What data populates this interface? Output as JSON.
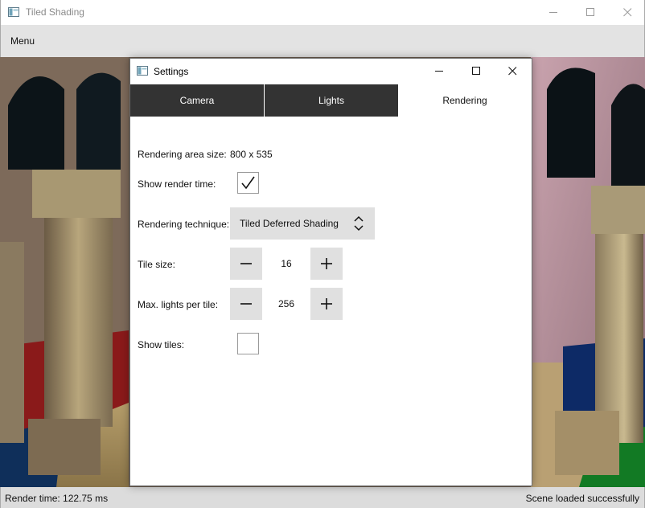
{
  "window": {
    "title": "Tiled Shading"
  },
  "menubar": {
    "menu_label": "Menu"
  },
  "statusbar": {
    "render_time": "Render time: 122.75 ms",
    "status_message": "Scene loaded successfully"
  },
  "dialog": {
    "title": "Settings",
    "tabs": [
      {
        "label": "Camera",
        "active": false
      },
      {
        "label": "Lights",
        "active": false
      },
      {
        "label": "Rendering",
        "active": true
      }
    ],
    "rendering": {
      "area_size_label": "Rendering area size:",
      "area_size_value": "800 x 535",
      "show_render_time_label": "Show render time:",
      "show_render_time_checked": true,
      "technique_label": "Rendering technique:",
      "technique_value": "Tiled Deferred Shading",
      "tile_size_label": "Tile size:",
      "tile_size_value": "16",
      "max_lights_label": "Max. lights per tile:",
      "max_lights_value": "256",
      "show_tiles_label": "Show tiles:",
      "show_tiles_checked": false
    }
  },
  "colors": {
    "tab_inactive": "#333333",
    "control_bg": "#e0e0e0",
    "menubar_bg": "#e3e3e3",
    "statusbar_bg": "#dcdcdc"
  },
  "icons": {
    "app": "window-app-icon",
    "minimize": "minimize-icon",
    "maximize": "maximize-icon",
    "close": "close-icon",
    "checkmark": "checkmark-icon",
    "combo": "updown-chevron-icon",
    "minus": "minus-icon",
    "plus": "plus-icon"
  }
}
